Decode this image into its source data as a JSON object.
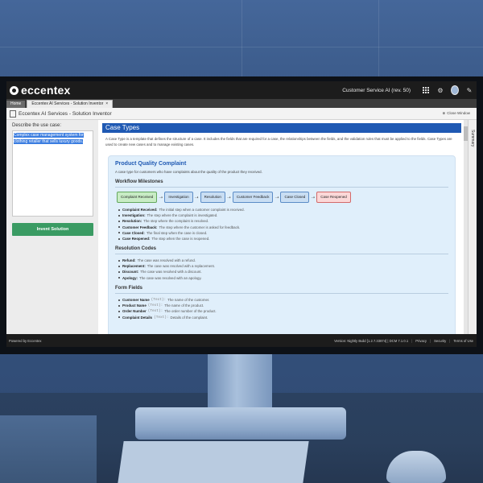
{
  "header": {
    "logo_text": "eccentex",
    "product": "Customer Service AI (rev. 50)",
    "icons": [
      "grid-icon",
      "gear-icon",
      "user-avatar",
      "pencil-icon"
    ]
  },
  "tabs": {
    "home": "Home",
    "active": "Eccentex AI Services - Solution Inventor",
    "close": "×"
  },
  "titlebar": {
    "title": "Eccentex AI Services - Solution Inventor",
    "close_window": "Close Window"
  },
  "left_panel": {
    "describe_label": "Describe the use case:",
    "use_case_text": "Complex case management system for clothing retailer that sells luxury goods.",
    "invent_button": "Invent Solution"
  },
  "main": {
    "case_types_header": "Case Types",
    "case_types_desc": "A Case Type is a template that defines the structure of a case. It includes the fields that are required for a case, the relationships between the fields, and the validation rules that must be applied to the fields. Case Types are used to create new cases and to manage existing cases.",
    "card_title": "Product Quality Complaint",
    "card_desc": "A case type for customers who have complaints about the quality of the product they received.",
    "workflow_title": "Workflow Milestones",
    "milestones": [
      "Complaint Received",
      "Investigation",
      "Resolution",
      "Customer Feedback",
      "Case Closed",
      "Case Reopened"
    ],
    "milestone_details": [
      {
        "name": "Complaint Received:",
        "desc": "The initial step when a customer complaint is received."
      },
      {
        "name": "Investigation:",
        "desc": "The step where the complaint is investigated."
      },
      {
        "name": "Resolution:",
        "desc": "The step where the complaint is resolved."
      },
      {
        "name": "Customer Feedback:",
        "desc": "The step where the customer is asked for feedback."
      },
      {
        "name": "Case Closed:",
        "desc": "The final step when the case is closed."
      },
      {
        "name": "Case Reopened:",
        "desc": "The step when the case is reopened."
      }
    ],
    "resolution_title": "Resolution Codes",
    "resolution_codes": [
      {
        "name": "Refund:",
        "desc": "The case was resolved with a refund."
      },
      {
        "name": "Replacement:",
        "desc": "The case was resolved with a replacement."
      },
      {
        "name": "Discount:",
        "desc": "The case was resolved with a discount."
      },
      {
        "name": "Apology:",
        "desc": "The case was resolved with an apology."
      }
    ],
    "form_title": "Form Fields",
    "form_fields": [
      {
        "name": "Customer Name",
        "type": "(Text):",
        "desc": "The name of the customer."
      },
      {
        "name": "Product Name",
        "type": "(Text):",
        "desc": "The name of the product."
      },
      {
        "name": "Order Number",
        "type": "(Text):",
        "desc": "The order number of the product."
      },
      {
        "name": "Complaint Details",
        "type": "(Text):",
        "desc": "Details of the complaint."
      }
    ]
  },
  "summary_rail": "Summary",
  "footer": {
    "powered_by": "Powered by Eccentex",
    "version": "Version: Nightly Build [1.2.7.33874] | DCM 7.1.0.1",
    "links": [
      "Privacy",
      "Security",
      "Terms of Use"
    ]
  }
}
